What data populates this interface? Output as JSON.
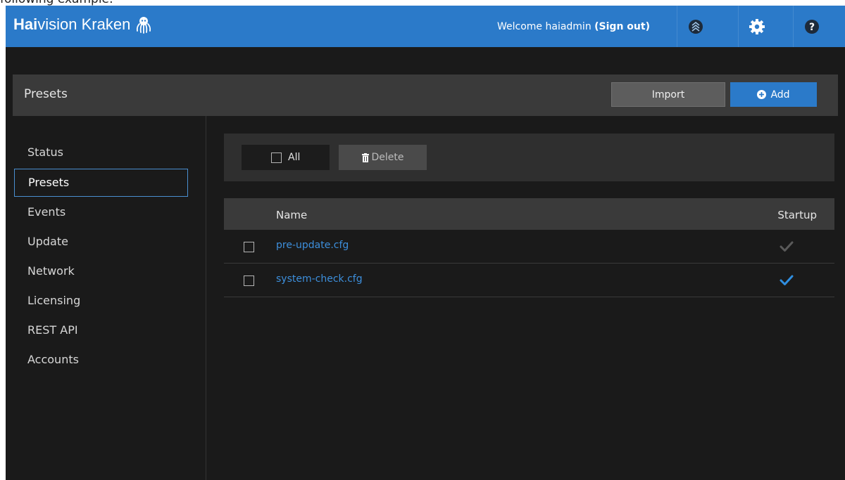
{
  "caption": "following example:",
  "header": {
    "brand_bold": "Hai",
    "brand_rest": "vision Kraken",
    "welcome_prefix": "Welcome haiadmin ",
    "signout_label": "(Sign out)",
    "icons": [
      "status-icon",
      "settings-gear-icon",
      "help-icon"
    ]
  },
  "page": {
    "title": "Presets",
    "import_label": "Import",
    "add_label": "Add"
  },
  "sidebar": {
    "items": [
      {
        "label": "Status",
        "active": false
      },
      {
        "label": "Presets",
        "active": true
      },
      {
        "label": "Events",
        "active": false
      },
      {
        "label": "Update",
        "active": false
      },
      {
        "label": "Network",
        "active": false
      },
      {
        "label": "Licensing",
        "active": false
      },
      {
        "label": "REST API",
        "active": false
      },
      {
        "label": "Accounts",
        "active": false
      }
    ]
  },
  "toolbar": {
    "all_label": "All",
    "delete_label": "Delete"
  },
  "table": {
    "columns": [
      "Name",
      "Startup"
    ],
    "rows": [
      {
        "name": "pre-update.cfg",
        "startup": false
      },
      {
        "name": "system-check.cfg",
        "startup": true
      }
    ]
  },
  "colors": {
    "accent": "#2b7ac9",
    "link": "#3d8fdc",
    "startup_on": "#2f8ee0",
    "startup_off": "#5a5a5a"
  }
}
